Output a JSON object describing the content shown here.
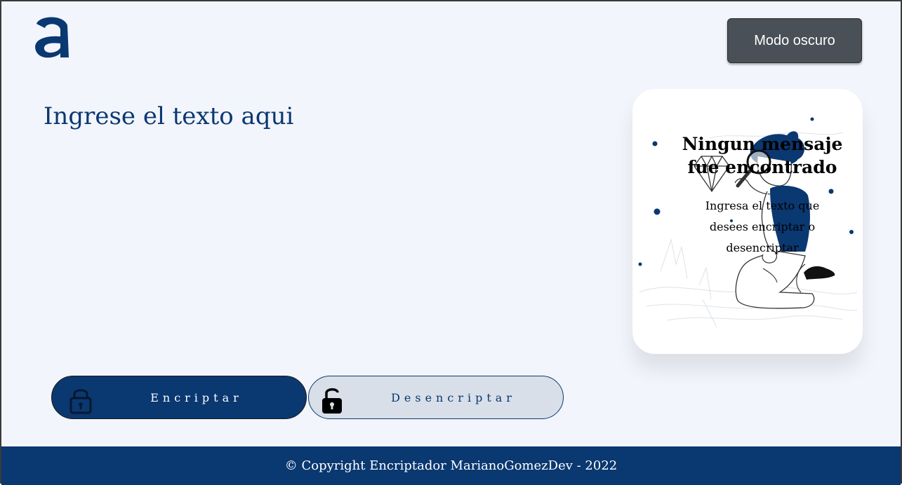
{
  "header": {
    "logo_alt": "a",
    "dark_mode_label": "Modo oscuro"
  },
  "input": {
    "placeholder": "Ingrese el texto aqui",
    "value": ""
  },
  "output_card": {
    "title": "Ningun mensaje fue encontrado",
    "text": "Ingresa el texto que desees encriptar o desencriptar",
    "illustration_icon": "person-with-magnifier-illustration"
  },
  "actions": {
    "encrypt_label": "Encriptar",
    "decrypt_label": "Desencriptar",
    "encrypt_icon": "lock-closed-icon",
    "decrypt_icon": "lock-open-icon"
  },
  "footer": {
    "copyright": "© Copyright Encriptador MarianoGomezDev - 2022"
  },
  "colors": {
    "primary": "#0a3871",
    "background": "#f3f5fc",
    "dark_button": "#495057",
    "secondary_button": "#d8dfe8"
  }
}
